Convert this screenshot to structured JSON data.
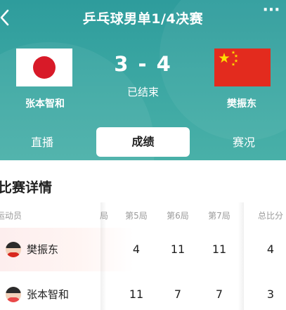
{
  "header": {
    "title": "乒乓球男单1/4决赛",
    "more": "···"
  },
  "match": {
    "home_player": "张本智和",
    "away_player": "樊振东",
    "home_flag": "japan-flag",
    "away_flag": "china-flag",
    "score": "3 - 4",
    "status": "已结束"
  },
  "tabs": [
    {
      "label": "直播",
      "active": false
    },
    {
      "label": "成绩",
      "active": true
    },
    {
      "label": "赛况",
      "active": false
    }
  ],
  "details": {
    "title": "比赛详情",
    "columns": {
      "player": "运动员",
      "partial": "局",
      "game5": "第5局",
      "game6": "第6局",
      "game7": "第7局",
      "total": "总比分"
    },
    "rows": [
      {
        "name": "樊振东",
        "g5": "4",
        "g6": "11",
        "g7": "11",
        "total": "4"
      },
      {
        "name": "张本智和",
        "g5": "11",
        "g6": "7",
        "g7": "7",
        "total": "3"
      }
    ]
  },
  "colors": {
    "hero_bg": "#3aa6a2",
    "china_red": "#e32b1e",
    "japan_red": "#d81a28",
    "winner_highlight": "#fdeeee"
  }
}
